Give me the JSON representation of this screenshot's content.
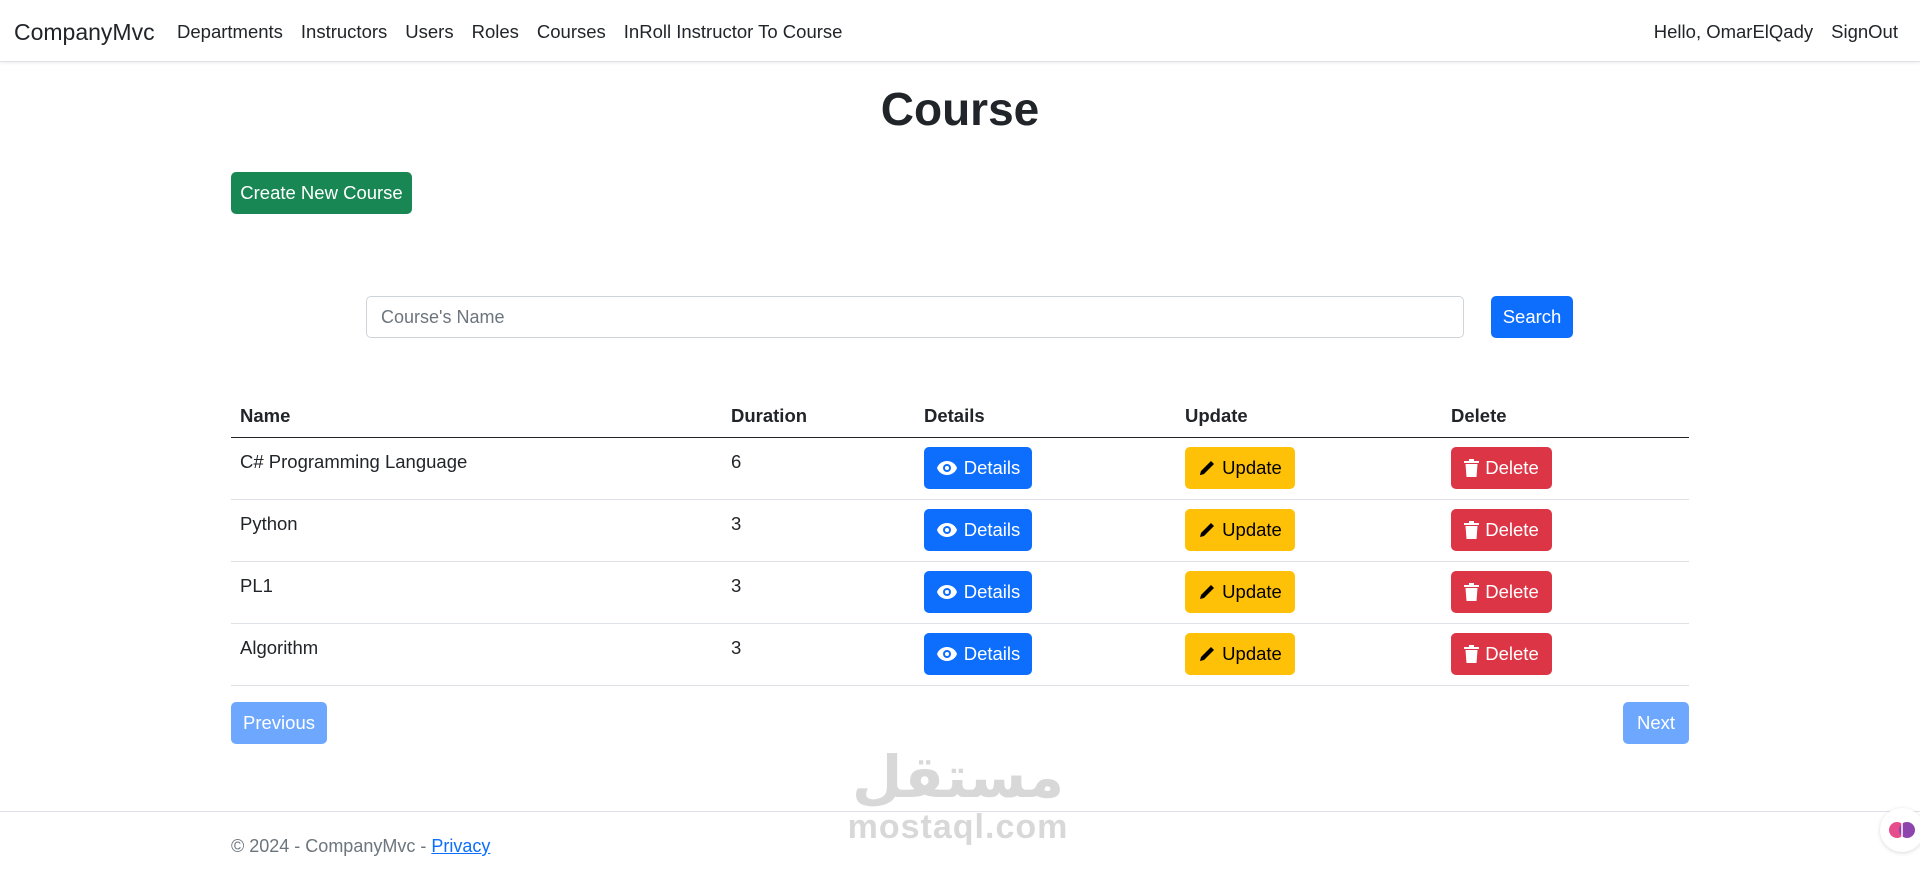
{
  "navbar": {
    "brand": "CompanyMvc",
    "links": [
      "Departments",
      "Instructors",
      "Users",
      "Roles",
      "Courses",
      "InRoll Instructor To Course"
    ],
    "greeting": "Hello, OmarElQady",
    "signout": "SignOut"
  },
  "page": {
    "title": "Course",
    "create_button": "Create New Course"
  },
  "search": {
    "placeholder": "Course's Name",
    "value": "",
    "button": "Search"
  },
  "table": {
    "headers": [
      "Name",
      "Duration",
      "Details",
      "Update",
      "Delete"
    ],
    "rows": [
      {
        "name": "C# Programming Language",
        "duration": "6"
      },
      {
        "name": "Python",
        "duration": "3"
      },
      {
        "name": "PL1",
        "duration": "3"
      },
      {
        "name": "Algorithm",
        "duration": "3"
      }
    ],
    "details_label": "Details",
    "update_label": "Update",
    "delete_label": "Delete"
  },
  "pagination": {
    "previous": "Previous",
    "next": "Next"
  },
  "footer": {
    "copyright": "© 2024 - CompanyMvc - ",
    "privacy": "Privacy"
  },
  "watermark": {
    "arabic": "مستقل",
    "latin": "mostaql.com"
  },
  "colors": {
    "success": "#198754",
    "primary": "#0d6efd",
    "warning": "#ffc107",
    "danger": "#dc3545",
    "disabled_primary": "#6ea8fe"
  },
  "icons": {
    "details": "eye-icon",
    "update": "pencil-icon",
    "delete": "trash-icon"
  }
}
